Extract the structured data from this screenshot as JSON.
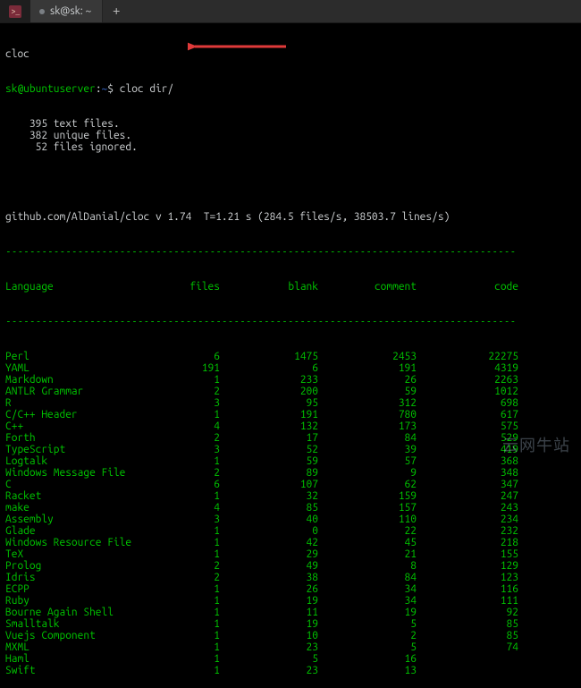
{
  "tab_bar": {
    "tab_title": "sk@sk: ~",
    "new_tab_glyph": "+"
  },
  "terminal": {
    "line_cloc": "cloc",
    "prompt_userhost": "sk@ubuntuserver",
    "prompt_sep1": ":",
    "prompt_tilde": "~",
    "prompt_dollar": "$",
    "command": "cloc dir/",
    "summary_lines": [
      "    395 text files.",
      "    382 unique files.",
      "     52 files ignored."
    ],
    "meta_line": "github.com/AlDanial/cloc v 1.74  T=1.21 s (284.5 files/s, 38503.7 lines/s)",
    "dash_line": "-------------------------------------------------------------------------------------",
    "header": {
      "language": "Language",
      "files": "files",
      "blank": "blank",
      "comment": "comment",
      "code": "code"
    },
    "rows": [
      {
        "language": "Perl",
        "files": "6",
        "blank": "1475",
        "comment": "2453",
        "code": "22275"
      },
      {
        "language": "YAML",
        "files": "191",
        "blank": "6",
        "comment": "191",
        "code": "4319"
      },
      {
        "language": "Markdown",
        "files": "1",
        "blank": "233",
        "comment": "26",
        "code": "2263"
      },
      {
        "language": "ANTLR Grammar",
        "files": "2",
        "blank": "200",
        "comment": "59",
        "code": "1012"
      },
      {
        "language": "R",
        "files": "3",
        "blank": "95",
        "comment": "312",
        "code": "698"
      },
      {
        "language": "C/C++ Header",
        "files": "1",
        "blank": "191",
        "comment": "780",
        "code": "617"
      },
      {
        "language": "C++",
        "files": "4",
        "blank": "132",
        "comment": "173",
        "code": "575"
      },
      {
        "language": "Forth",
        "files": "2",
        "blank": "17",
        "comment": "84",
        "code": "529"
      },
      {
        "language": "TypeScript",
        "files": "3",
        "blank": "52",
        "comment": "39",
        "code": "419"
      },
      {
        "language": "Logtalk",
        "files": "1",
        "blank": "59",
        "comment": "57",
        "code": "368"
      },
      {
        "language": "Windows Message File",
        "files": "2",
        "blank": "89",
        "comment": "9",
        "code": "348"
      },
      {
        "language": "C",
        "files": "6",
        "blank": "107",
        "comment": "62",
        "code": "347"
      },
      {
        "language": "Racket",
        "files": "1",
        "blank": "32",
        "comment": "159",
        "code": "247"
      },
      {
        "language": "make",
        "files": "4",
        "blank": "85",
        "comment": "157",
        "code": "243"
      },
      {
        "language": "Assembly",
        "files": "3",
        "blank": "40",
        "comment": "110",
        "code": "234"
      },
      {
        "language": "Glade",
        "files": "1",
        "blank": "0",
        "comment": "22",
        "code": "232"
      },
      {
        "language": "Windows Resource File",
        "files": "1",
        "blank": "42",
        "comment": "45",
        "code": "218"
      },
      {
        "language": "TeX",
        "files": "1",
        "blank": "29",
        "comment": "21",
        "code": "155"
      },
      {
        "language": "Prolog",
        "files": "2",
        "blank": "49",
        "comment": "8",
        "code": "129"
      },
      {
        "language": "Idris",
        "files": "2",
        "blank": "38",
        "comment": "84",
        "code": "123"
      },
      {
        "language": "ECPP",
        "files": "1",
        "blank": "26",
        "comment": "34",
        "code": "116"
      },
      {
        "language": "Ruby",
        "files": "1",
        "blank": "19",
        "comment": "34",
        "code": "111"
      },
      {
        "language": "Bourne Again Shell",
        "files": "1",
        "blank": "11",
        "comment": "19",
        "code": "92"
      },
      {
        "language": "Smalltalk",
        "files": "1",
        "blank": "19",
        "comment": "5",
        "code": "85"
      },
      {
        "language": "Vuejs Component",
        "files": "1",
        "blank": "10",
        "comment": "2",
        "code": "85"
      },
      {
        "language": "MXML",
        "files": "1",
        "blank": "23",
        "comment": "5",
        "code": "74"
      },
      {
        "language": "Haml",
        "files": "1",
        "blank": "5",
        "comment": "16",
        "code": ""
      },
      {
        "language": "Swift",
        "files": "1",
        "blank": "23",
        "comment": "13",
        "code": ""
      }
    ]
  },
  "watermark": "云网牛站"
}
